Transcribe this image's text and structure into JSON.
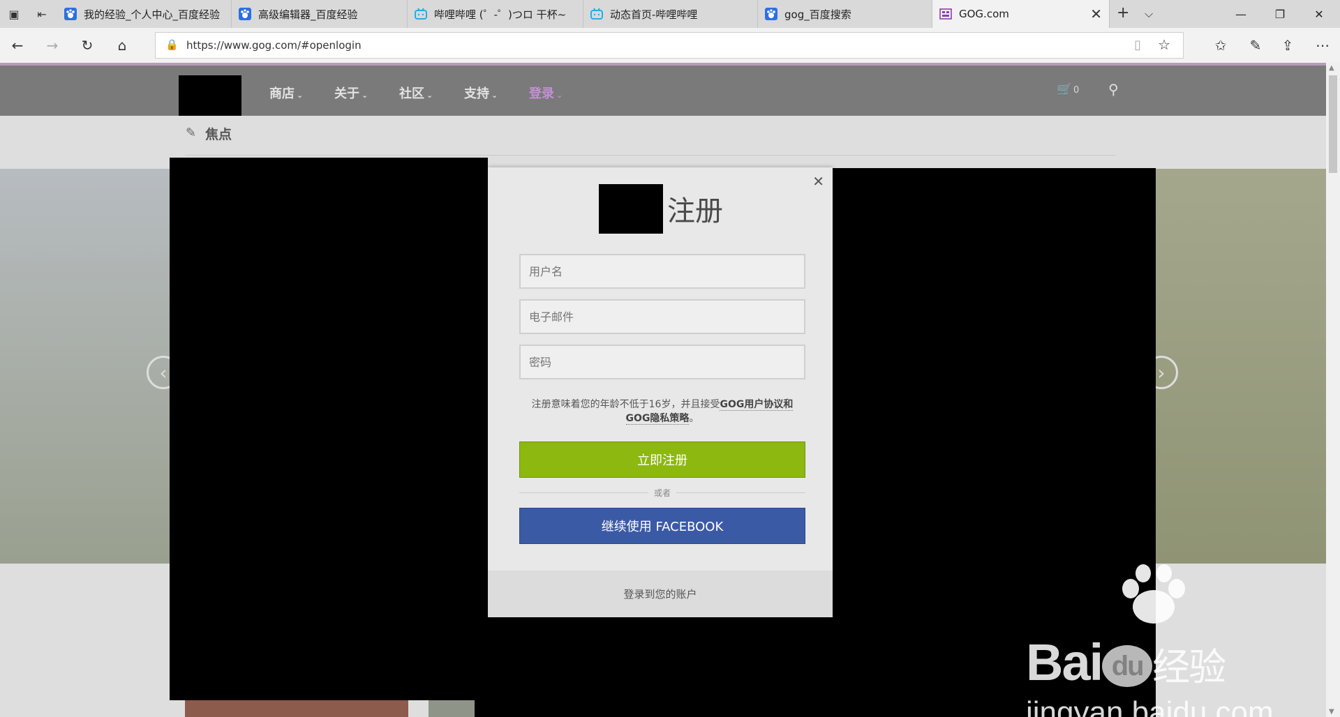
{
  "browser": {
    "tabs": [
      {
        "title": "我的经验_个人中心_百度经验",
        "icon": "baidu-paw-icon"
      },
      {
        "title": "高级编辑器_百度经验",
        "icon": "baidu-paw-icon"
      },
      {
        "title": "哔哩哔哩 (゜-゜)つロ 干杯~",
        "icon": "bilibili-icon"
      },
      {
        "title": "动态首页-哔哩哔哩",
        "icon": "bilibili-icon"
      },
      {
        "title": "gog_百度搜索",
        "icon": "baidu-paw-icon"
      },
      {
        "title": "GOG.com",
        "icon": "gog-icon"
      }
    ],
    "new_tab_glyph": "+",
    "tab_menu_glyph": "⌵",
    "url": "https://www.gog.com/#openlogin"
  },
  "site": {
    "nav": [
      {
        "label": "商店"
      },
      {
        "label": "关于"
      },
      {
        "label": "社区"
      },
      {
        "label": "支持"
      },
      {
        "label": "登录"
      }
    ],
    "cart_count": "0",
    "section_title": "焦点"
  },
  "modal": {
    "title": "注册",
    "username_placeholder": "用户名",
    "email_placeholder": "电子邮件",
    "password_placeholder": "密码",
    "terms_prefix": "注册意味着您的年龄不低于16岁，并且接受",
    "terms_link1": "GOG用户协议和",
    "terms_link2": "GOG隐私策略",
    "terms_suffix": "。",
    "register_button": "立即注册",
    "or_text": "或者",
    "facebook_button": "继续使用 FACEBOOK",
    "footer_link": "登录到您的账户"
  },
  "watermark": {
    "brand": "Bai",
    "brand2": "du",
    "brand_suffix": "经验",
    "url": "jingyan.baidu.com"
  },
  "colors": {
    "nav_bg": "#7a7a7a",
    "login_accent": "#c58fd6",
    "green_button": "#8db80f",
    "facebook_blue": "#3b5aa6"
  }
}
